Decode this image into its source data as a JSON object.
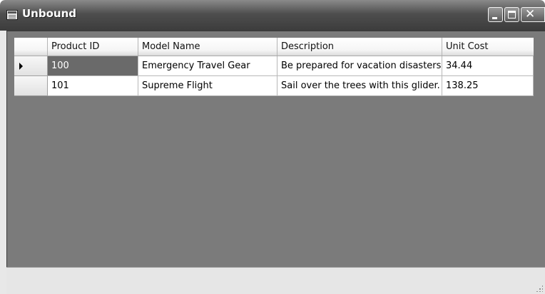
{
  "window": {
    "title": "Unbound",
    "icon": "form-icon",
    "controls": [
      "minimize-icon",
      "maximize-icon",
      "close-icon"
    ]
  },
  "grid": {
    "columns": [
      "Product ID",
      "Model Name",
      "Description",
      "Unit Cost"
    ],
    "rows": [
      {
        "current": true,
        "cells": [
          "100",
          "Emergency Travel Gear",
          "Be prepared for vacation disasters.",
          "34.44"
        ]
      },
      {
        "current": false,
        "cells": [
          "101",
          "Supreme Flight",
          "Sail over the trees with this glider.",
          "138.25"
        ]
      }
    ],
    "selected_cell": "rows.0.cells.0",
    "current_row_icon": "row-pointer-icon"
  },
  "colors": {
    "titlebar": "#4e4e4e",
    "grid_background": "#7b7b7b",
    "selection": "#6a6a6a"
  }
}
